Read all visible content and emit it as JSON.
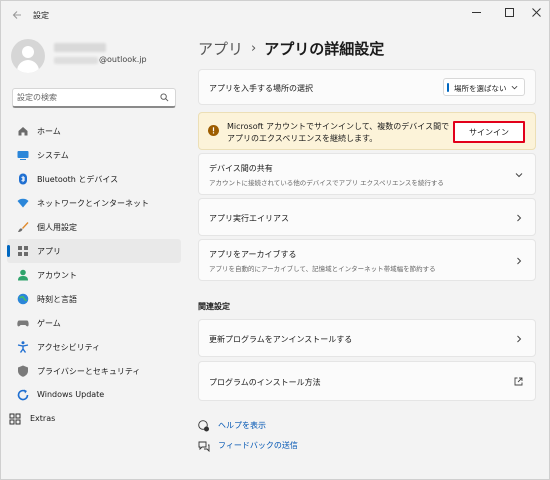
{
  "window": {
    "title": "設定"
  },
  "profile": {
    "email_suffix": "@outlook.jp"
  },
  "search": {
    "placeholder": "設定の検索"
  },
  "sidebar": {
    "items": [
      {
        "label": "ホーム",
        "icon": "home-icon",
        "active": false
      },
      {
        "label": "システム",
        "icon": "system-icon",
        "active": false
      },
      {
        "label": "Bluetooth とデバイス",
        "icon": "bluetooth-icon",
        "active": false
      },
      {
        "label": "ネットワークとインターネット",
        "icon": "network-icon",
        "active": false
      },
      {
        "label": "個人用設定",
        "icon": "brush-icon",
        "active": false
      },
      {
        "label": "アプリ",
        "icon": "apps-icon",
        "active": true
      },
      {
        "label": "アカウント",
        "icon": "account-icon",
        "active": false
      },
      {
        "label": "時刻と言語",
        "icon": "globe-clock-icon",
        "active": false
      },
      {
        "label": "ゲーム",
        "icon": "gamepad-icon",
        "active": false
      },
      {
        "label": "アクセシビリティ",
        "icon": "accessibility-icon",
        "active": false
      },
      {
        "label": "プライバシーとセキュリティ",
        "icon": "shield-icon",
        "active": false
      },
      {
        "label": "Windows Update",
        "icon": "update-icon",
        "active": false
      },
      {
        "label": "Extras",
        "icon": "extras-icon",
        "active": false
      }
    ]
  },
  "breadcrumb": {
    "parent": "アプリ",
    "separator": "›",
    "current": "アプリの詳細設定"
  },
  "source_card": {
    "title": "アプリを入手する場所の選択",
    "dropdown_value": "場所を選ばない"
  },
  "warning": {
    "line1": "Microsoft アカウントでサインインして、複数のデバイス間で",
    "line2": "アプリのエクスペリエンスを継続します。",
    "button_label": "サインイン"
  },
  "share_card": {
    "title": "デバイス間の共有",
    "subtitle": "アカウントに接続されている他のデバイスでアプリ エクスペリエンスを続行する"
  },
  "alias_card": {
    "title": "アプリ実行エイリアス"
  },
  "archive_card": {
    "title": "アプリをアーカイブする",
    "subtitle": "アプリを自動的にアーカイブして、記憶域とインターネット帯域幅を節約する"
  },
  "related": {
    "title": "関連設定",
    "uninstall": "更新プログラムをアンインストールする",
    "install_howto": "プログラムのインストール方法"
  },
  "footer": {
    "help": "ヘルプを表示",
    "feedback": "フィードバックの送信"
  },
  "colors": {
    "accent": "#0067c0",
    "warning_bg": "#fcf3d9",
    "highlight_border": "#e2001a"
  }
}
